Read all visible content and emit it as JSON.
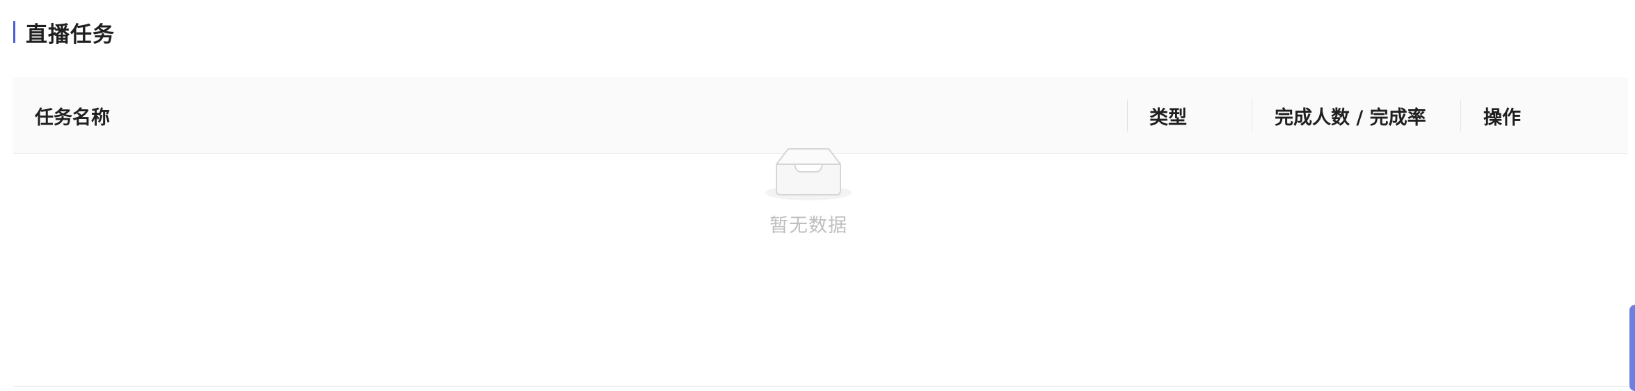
{
  "section": {
    "title": "直播任务"
  },
  "table": {
    "columns": [
      "任务名称",
      "类型",
      "完成人数 / 完成率",
      "操作"
    ],
    "empty_text": "暂无数据"
  },
  "colors": {
    "accent": "#4a5cd6",
    "header_bg": "#fafafa",
    "empty_text": "#bfbfbf"
  },
  "icons": {
    "empty": "empty-inbox-icon"
  }
}
